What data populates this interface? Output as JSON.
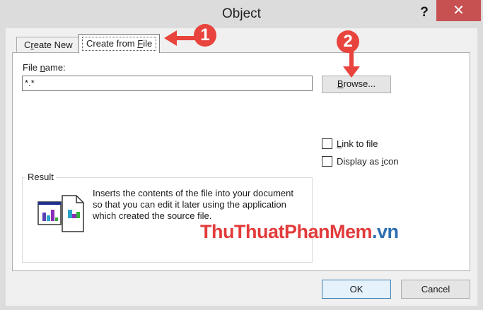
{
  "window": {
    "title": "Object",
    "help_label": "?",
    "close_label": "✕"
  },
  "tabs": [
    {
      "label_prefix": "C",
      "label_ul": "r",
      "label_rest": "eate New",
      "selected": false
    },
    {
      "label_prefix": "Create from ",
      "label_ul": "F",
      "label_rest": "ile",
      "selected": true
    }
  ],
  "file_name": {
    "label_prefix": "File ",
    "label_ul": "n",
    "label_rest": "ame:",
    "value": "*.*"
  },
  "browse_button": {
    "label_ul": "B",
    "label_rest": "rowse..."
  },
  "options": [
    {
      "label_prefix": "",
      "label_ul": "L",
      "label_rest": "ink to file",
      "checked": false
    },
    {
      "label_prefix": "Display as ",
      "label_ul": "i",
      "label_rest": "con",
      "checked": false
    }
  ],
  "result": {
    "legend": "Result",
    "lines": [
      "Inserts the contents of the file into your document",
      "so that you can edit it later using the application",
      "which created the source file."
    ],
    "icon": "insert-file-icon"
  },
  "watermark": {
    "part_a": "ThuThuat",
    "part_b": "PhanMem",
    "part_c": ".vn"
  },
  "buttons": {
    "ok": "OK",
    "cancel": "Cancel"
  },
  "annotations": {
    "marker_1": "1",
    "marker_2": "2"
  },
  "colors": {
    "marker": "#e8433d",
    "close": "#c75050",
    "ok_border": "#3c7fb1"
  }
}
